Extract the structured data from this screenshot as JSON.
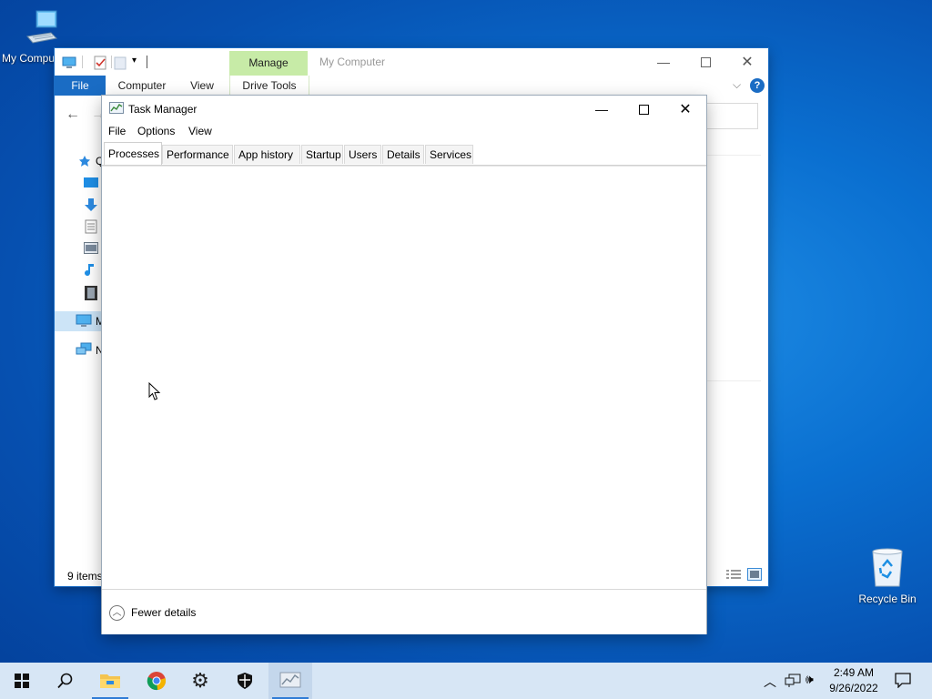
{
  "desktop": {
    "icons": [
      {
        "label": "My Computer"
      },
      {
        "label": "Recycle Bin"
      }
    ]
  },
  "explorer": {
    "title": "My Computer",
    "manage_tab": "Manage",
    "ribbon": {
      "file": "File",
      "computer": "Computer",
      "view": "View",
      "drive_tools": "Drive Tools"
    },
    "status_items": "9 items",
    "nav_partial": {
      "quick": "Q",
      "my": "M",
      "net": "N"
    }
  },
  "task_manager": {
    "title": "Task Manager",
    "menu": [
      "File",
      "Options",
      "View"
    ],
    "tabs": [
      "Processes",
      "Performance",
      "App history",
      "Startup",
      "Users",
      "Details",
      "Services"
    ],
    "active_tab": "Processes",
    "footer_toggle": "Fewer details"
  },
  "taskbar": {
    "time": "2:49 AM",
    "date": "9/26/2022"
  },
  "colors": {
    "accent": "#1a6cc4",
    "manage_tab": "#c7eba7",
    "taskbar": "#d7e6f5"
  }
}
